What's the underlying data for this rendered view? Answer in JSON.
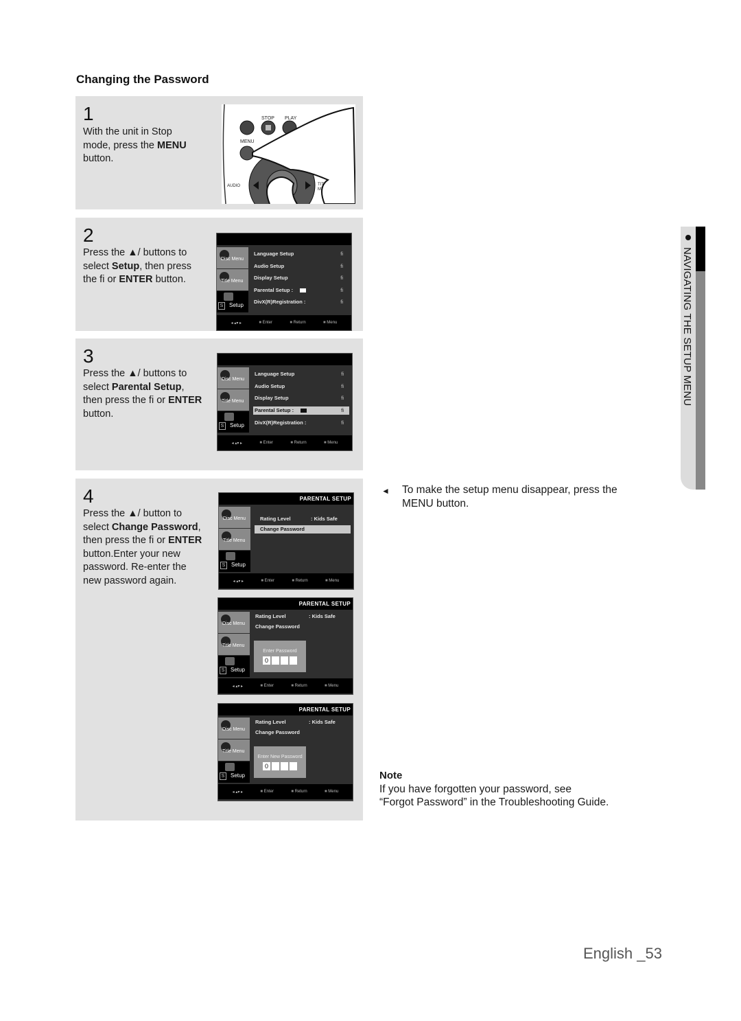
{
  "section_title": "Changing the Password",
  "steps": [
    {
      "number": "1",
      "text_html_parts": [
        "With the unit in Stop mode, press the ",
        "MENU",
        " button."
      ],
      "remote_labels": {
        "stop": "STOP",
        "play": "PLAY",
        "menu": "MENU",
        "audio": "AUDIO",
        "title_menu": "TITLE MENU"
      }
    },
    {
      "number": "2",
      "parts": [
        "Press the ▲/  buttons to select ",
        "Setup",
        ", then press the fi or ",
        "ENTER",
        " button."
      ]
    },
    {
      "number": "3",
      "parts": [
        "Press the ▲/  buttons to select ",
        "Parental Setup",
        ", then press the fi or ",
        "ENTER",
        " button."
      ]
    },
    {
      "number": "4",
      "parts": [
        "Press the ▲/  button to select ",
        "Change Password",
        ", then press the fi or ",
        "ENTER",
        " button.Enter your new password. Re-enter the new password again."
      ]
    }
  ],
  "osd": {
    "side_items": [
      "Disc Menu",
      "Title Menu",
      "Setup"
    ],
    "setup_box": "S",
    "setup_menu": [
      "Language Setup",
      "Audio Setup",
      "Display Setup",
      "Parental Setup :",
      "DivX(R)Registration :"
    ],
    "arrow": "fi",
    "footer": {
      "enter": "Enter",
      "return": "Return",
      "menu": "Menu"
    },
    "parental_header": "PARENTAL SETUP",
    "rating_label": "Rating Level",
    "rating_value": ": Kids Safe",
    "change_password": "Change Password",
    "enter_password": "Enter Password",
    "enter_new_password": "Enter New Password",
    "first_digit": "0"
  },
  "tip": {
    "icon": "◄",
    "text": "To make the setup menu disappear, press the MENU button."
  },
  "note": {
    "title": "Note",
    "line1": "If you have forgotten your password, see",
    "line2": "“Forgot Password” in the Troubleshooting Guide."
  },
  "side_tab": {
    "label": "NAVIGATING THE SETUP MENU"
  },
  "footer": {
    "page_label": "English _53"
  }
}
